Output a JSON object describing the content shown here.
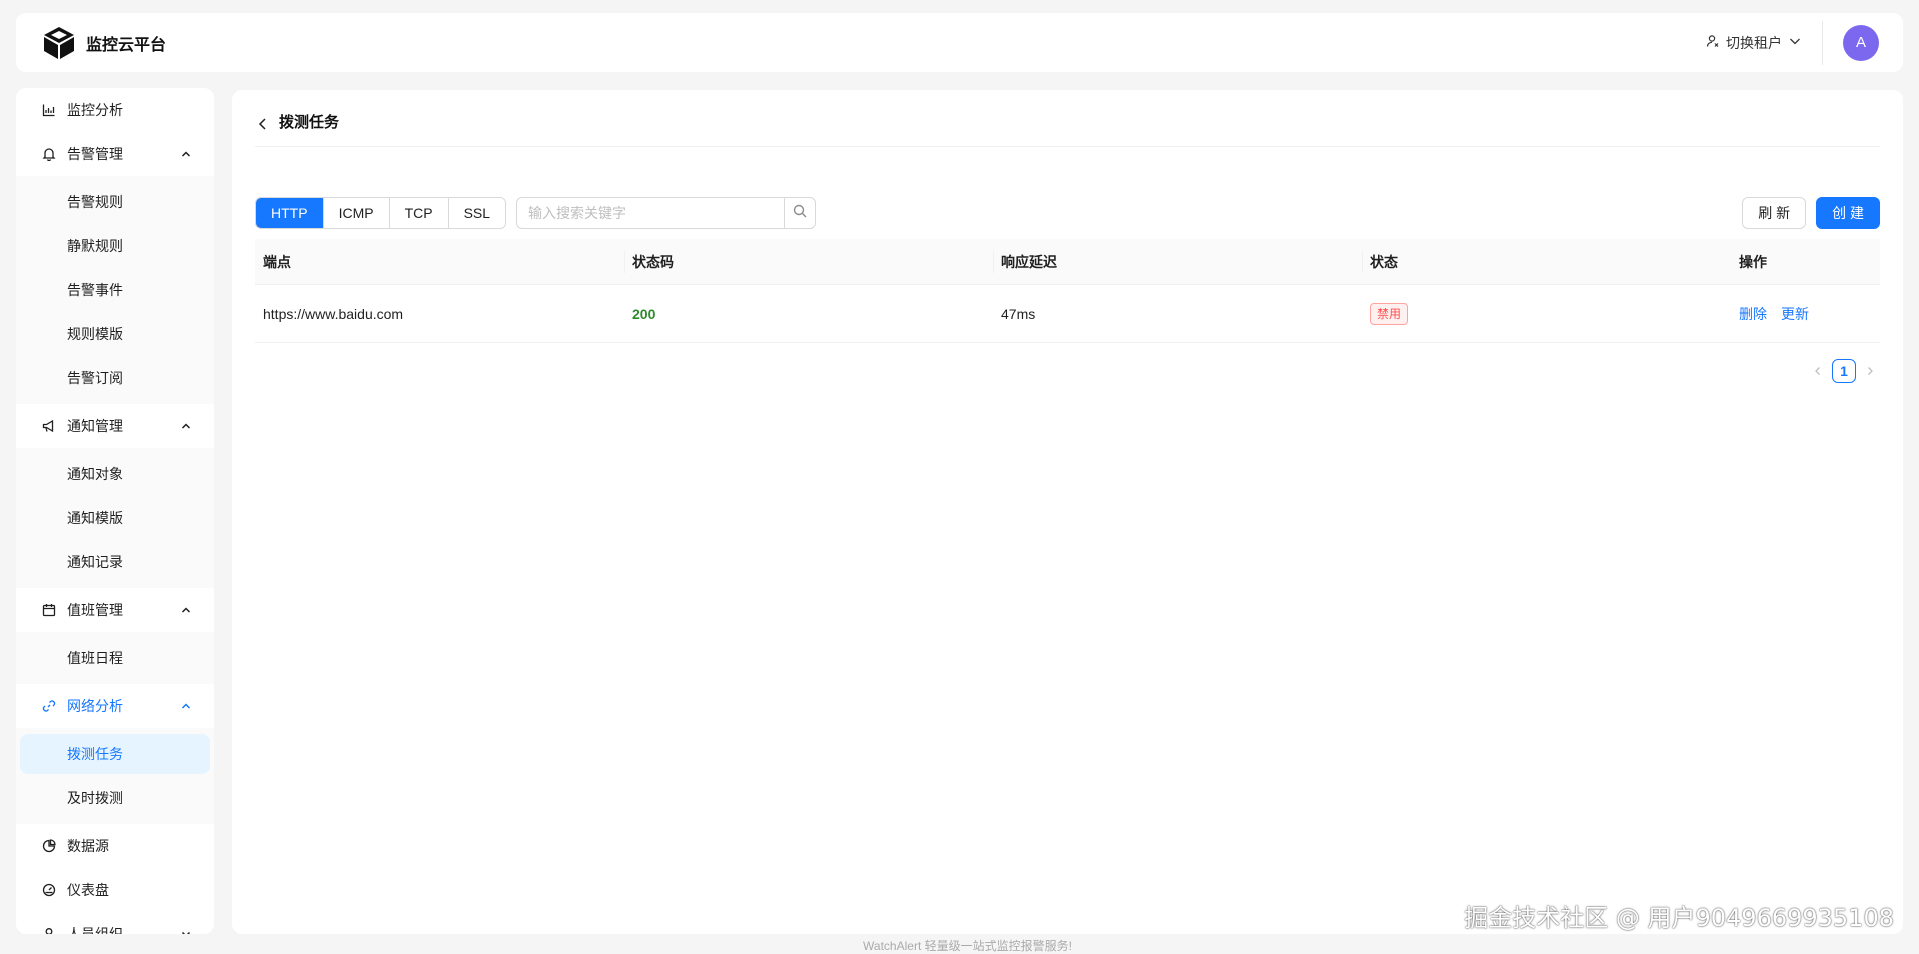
{
  "header": {
    "brand_title": "监控云平台",
    "tenant_switch_label": "切换租户",
    "avatar_initial": "A"
  },
  "sidebar": {
    "items": [
      {
        "label": "监控分析",
        "icon": "bar-chart-icon"
      },
      {
        "label": "告警管理",
        "icon": "bell-icon",
        "children": [
          "告警规则",
          "静默规则",
          "告警事件",
          "规则模版",
          "告警订阅"
        ]
      },
      {
        "label": "通知管理",
        "icon": "megaphone-icon",
        "children": [
          "通知对象",
          "通知模版",
          "通知记录"
        ]
      },
      {
        "label": "值班管理",
        "icon": "calendar-icon",
        "children": [
          "值班日程"
        ]
      },
      {
        "label": "网络分析",
        "icon": "link-icon",
        "children": [
          "拨测任务",
          "及时拨测"
        ],
        "active_child": "拨测任务"
      },
      {
        "label": "数据源",
        "icon": "pie-chart-icon"
      },
      {
        "label": "仪表盘",
        "icon": "dashboard-icon"
      },
      {
        "label": "人员组织",
        "icon": "user-icon"
      }
    ]
  },
  "page": {
    "title": "拨测任务"
  },
  "toolbar": {
    "tabs": [
      "HTTP",
      "ICMP",
      "TCP",
      "SSL"
    ],
    "active_tab": "HTTP",
    "search_placeholder": "输入搜索关键字",
    "refresh_label": "刷 新",
    "create_label": "创 建"
  },
  "table": {
    "columns": [
      "端点",
      "状态码",
      "响应延迟",
      "状态",
      "操作"
    ],
    "rows": [
      {
        "endpoint": "https://www.baidu.com",
        "status_code": "200",
        "latency": "47ms",
        "status": "禁用",
        "actions": [
          "删除",
          "更新"
        ]
      }
    ]
  },
  "pagination": {
    "current_page": "1"
  },
  "footer": {
    "text": "WatchAlert 轻量级一站式监控报警服务!"
  },
  "watermark": {
    "text": "掘金技术社区 @ 用户9049669935108"
  },
  "colors": {
    "primary": "#1677ff",
    "success": "#2e8b2e",
    "danger": "#ff4d4f",
    "avatar": "#7b68ee"
  }
}
